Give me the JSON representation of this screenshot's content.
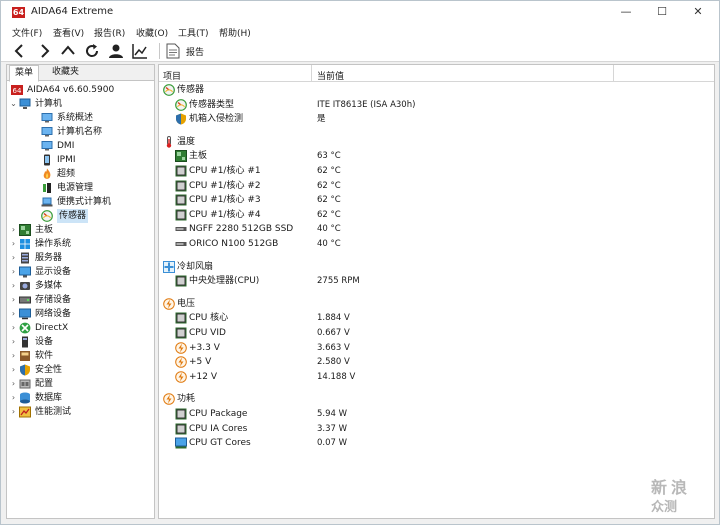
{
  "window": {
    "title": "AIDA64 Extreme",
    "logo_text": "64",
    "min_glyph": "—",
    "max_glyph": "☐",
    "close_glyph": "✕"
  },
  "menu": [
    "文件(F)",
    "查看(V)",
    "报告(R)",
    "收藏(O)",
    "工具(T)",
    "帮助(H)"
  ],
  "toolbar": {
    "report_label": "报告",
    "icons": [
      "back-icon",
      "forward-icon",
      "up-icon",
      "refresh-icon",
      "user-icon",
      "chart-icon"
    ]
  },
  "left": {
    "tabs": [
      "菜单",
      "收藏夹"
    ],
    "tree": [
      {
        "label": "AIDA64 v6.60.5900",
        "icon": "aida-icon",
        "level": 0,
        "exp": ""
      },
      {
        "label": "计算机",
        "icon": "computer-icon",
        "level": 1,
        "exp": "⌄"
      },
      {
        "label": "系统概述",
        "icon": "monitor-icon",
        "level": 2,
        "exp": ""
      },
      {
        "label": "计算机名称",
        "icon": "monitor-icon",
        "level": 2,
        "exp": ""
      },
      {
        "label": "DMI",
        "icon": "monitor-icon",
        "level": 2,
        "exp": ""
      },
      {
        "label": "IPMI",
        "icon": "phone-icon",
        "level": 2,
        "exp": ""
      },
      {
        "label": "超频",
        "icon": "flame-icon",
        "level": 2,
        "exp": ""
      },
      {
        "label": "电源管理",
        "icon": "power-icon",
        "level": 2,
        "exp": ""
      },
      {
        "label": "便携式计算机",
        "icon": "laptop-icon",
        "level": 2,
        "exp": ""
      },
      {
        "label": "传感器",
        "icon": "sensor-icon",
        "level": 2,
        "exp": "",
        "selected": true
      },
      {
        "label": "主板",
        "icon": "board-icon",
        "level": 1,
        "exp": "›"
      },
      {
        "label": "操作系统",
        "icon": "windows-icon",
        "level": 1,
        "exp": "›"
      },
      {
        "label": "服务器",
        "icon": "server-icon",
        "level": 1,
        "exp": "›"
      },
      {
        "label": "显示设备",
        "icon": "display-icon",
        "level": 1,
        "exp": "›"
      },
      {
        "label": "多媒体",
        "icon": "media-icon",
        "level": 1,
        "exp": "›"
      },
      {
        "label": "存储设备",
        "icon": "storage-icon",
        "level": 1,
        "exp": "›"
      },
      {
        "label": "网络设备",
        "icon": "network-icon",
        "level": 1,
        "exp": "›"
      },
      {
        "label": "DirectX",
        "icon": "xbox-icon",
        "level": 1,
        "exp": "›"
      },
      {
        "label": "设备",
        "icon": "device-icon",
        "level": 1,
        "exp": "›"
      },
      {
        "label": "软件",
        "icon": "software-icon",
        "level": 1,
        "exp": "›"
      },
      {
        "label": "安全性",
        "icon": "shield-icon",
        "level": 1,
        "exp": "›"
      },
      {
        "label": "配置",
        "icon": "config-icon",
        "level": 1,
        "exp": "›"
      },
      {
        "label": "数据库",
        "icon": "database-icon",
        "level": 1,
        "exp": "›"
      },
      {
        "label": "性能测试",
        "icon": "benchmark-icon",
        "level": 1,
        "exp": "›"
      }
    ]
  },
  "right": {
    "col_item": "项目",
    "col_value": "当前值",
    "rows": [
      {
        "kind": "group",
        "label": "传感器",
        "icon": "sensor-icon"
      },
      {
        "kind": "item",
        "label": "传感器类型",
        "value": "ITE IT8613E  (ISA A30h)",
        "icon": "sensor-icon"
      },
      {
        "kind": "item",
        "label": "机箱入侵检测",
        "value": "是",
        "icon": "shield-icon"
      },
      {
        "kind": "gap"
      },
      {
        "kind": "group",
        "label": "温度",
        "icon": "thermometer-icon"
      },
      {
        "kind": "item",
        "label": "主板",
        "value": "63 °C",
        "icon": "board-icon"
      },
      {
        "kind": "item",
        "label": "CPU #1/核心 #1",
        "value": "62 °C",
        "icon": "chip-icon"
      },
      {
        "kind": "item",
        "label": "CPU #1/核心 #2",
        "value": "62 °C",
        "icon": "chip-icon"
      },
      {
        "kind": "item",
        "label": "CPU #1/核心 #3",
        "value": "62 °C",
        "icon": "chip-icon"
      },
      {
        "kind": "item",
        "label": "CPU #1/核心 #4",
        "value": "62 °C",
        "icon": "chip-icon"
      },
      {
        "kind": "item",
        "label": "NGFF 2280 512GB SSD",
        "value": "40 °C",
        "icon": "disk-icon"
      },
      {
        "kind": "item",
        "label": "ORICO N100 512GB",
        "value": "40 °C",
        "icon": "disk-icon"
      },
      {
        "kind": "gap"
      },
      {
        "kind": "group",
        "label": "冷却风扇",
        "icon": "fan-icon"
      },
      {
        "kind": "item",
        "label": "中央处理器(CPU)",
        "value": "2755 RPM",
        "icon": "chip-icon"
      },
      {
        "kind": "gap"
      },
      {
        "kind": "group",
        "label": "电压",
        "icon": "voltage-icon"
      },
      {
        "kind": "item",
        "label": "CPU 核心",
        "value": "1.884 V",
        "icon": "chip-icon"
      },
      {
        "kind": "item",
        "label": "CPU VID",
        "value": "0.667 V",
        "icon": "chip-icon"
      },
      {
        "kind": "item",
        "label": "+3.3 V",
        "value": "3.663 V",
        "icon": "voltage-icon"
      },
      {
        "kind": "item",
        "label": "+5 V",
        "value": "2.580 V",
        "icon": "voltage-icon"
      },
      {
        "kind": "item",
        "label": "+12 V",
        "value": "14.188 V",
        "icon": "voltage-icon"
      },
      {
        "kind": "gap"
      },
      {
        "kind": "group",
        "label": "功耗",
        "icon": "voltage-icon"
      },
      {
        "kind": "item",
        "label": "CPU Package",
        "value": "5.94 W",
        "icon": "chip-icon"
      },
      {
        "kind": "item",
        "label": "CPU IA Cores",
        "value": "3.37 W",
        "icon": "chip-icon"
      },
      {
        "kind": "item",
        "label": "CPU GT Cores",
        "value": "0.07 W",
        "icon": "gpu-icon"
      }
    ]
  },
  "watermark": [
    "新",
    "浪",
    "众测"
  ]
}
